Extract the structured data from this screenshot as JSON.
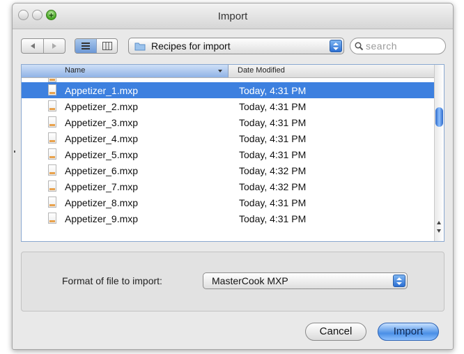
{
  "window": {
    "title": "Import"
  },
  "toolbar": {
    "back_icon": "chevron-left-icon",
    "forward_icon": "chevron-right-icon",
    "list_view_icon": "list-view-icon",
    "column_view_icon": "column-view-icon",
    "location": "Recipes for import",
    "search_placeholder": "search"
  },
  "browser": {
    "columns": [
      "Name",
      "Date Modified"
    ],
    "files": [
      {
        "name": "Appetizer_1.mxp",
        "date": "Today, 4:31 PM",
        "selected": true
      },
      {
        "name": "Appetizer_2.mxp",
        "date": "Today, 4:31 PM"
      },
      {
        "name": "Appetizer_3.mxp",
        "date": "Today, 4:31 PM"
      },
      {
        "name": "Appetizer_4.mxp",
        "date": "Today, 4:31 PM"
      },
      {
        "name": "Appetizer_5.mxp",
        "date": "Today, 4:31 PM"
      },
      {
        "name": "Appetizer_6.mxp",
        "date": "Today, 4:32 PM"
      },
      {
        "name": "Appetizer_7.mxp",
        "date": "Today, 4:32 PM"
      },
      {
        "name": "Appetizer_8.mxp",
        "date": "Today, 4:31 PM"
      },
      {
        "name": "Appetizer_9.mxp",
        "date": "Today, 4:31 PM"
      }
    ]
  },
  "format": {
    "label": "Format of file to import:",
    "value": "MasterCook MXP"
  },
  "buttons": {
    "cancel": "Cancel",
    "import": "Import"
  },
  "colors": {
    "selection": "#3d80df",
    "default_button": "#4a8fe6"
  }
}
